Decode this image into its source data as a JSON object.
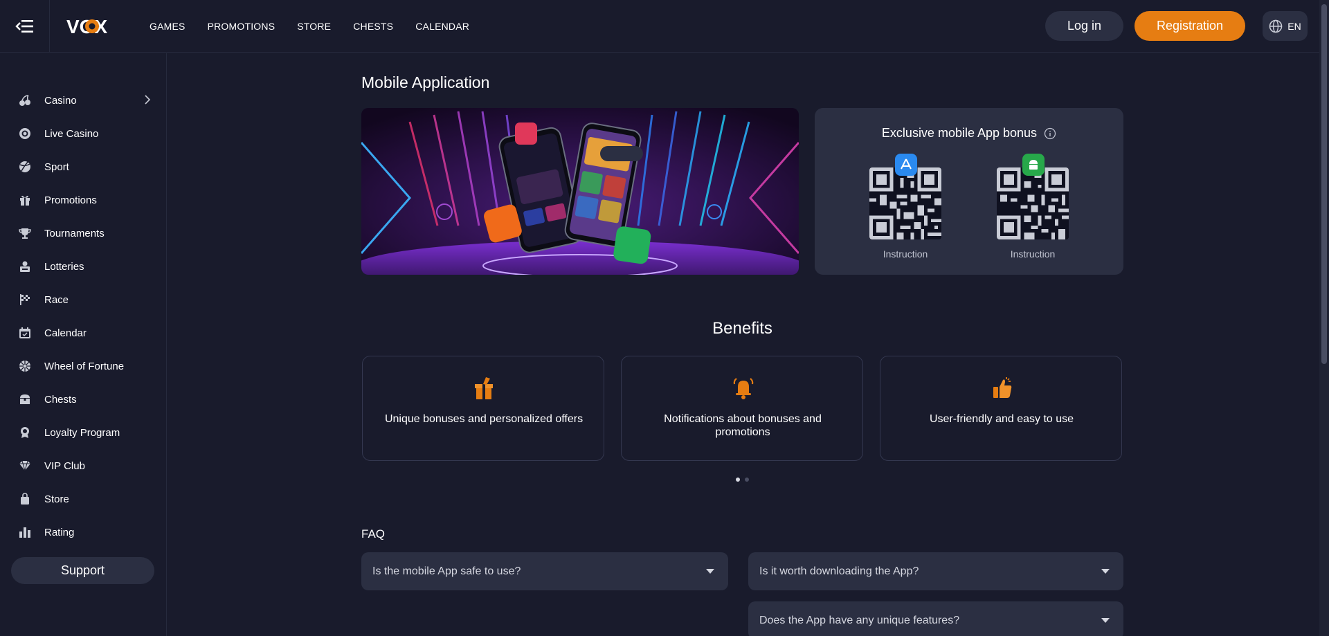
{
  "brand": {
    "logo_text": "VOX"
  },
  "topnav": {
    "items": [
      "GAMES",
      "PROMOTIONS",
      "STORE",
      "CHESTS",
      "CALENDAR"
    ]
  },
  "header": {
    "login_label": "Log in",
    "register_label": "Registration",
    "language": "EN"
  },
  "sidebar": {
    "items": [
      {
        "label": "Casino",
        "icon": "cherry-icon"
      },
      {
        "label": "Live Casino",
        "icon": "chip-icon"
      },
      {
        "label": "Sport",
        "icon": "ball-icon"
      },
      {
        "label": "Promotions",
        "icon": "gift-icon"
      },
      {
        "label": "Tournaments",
        "icon": "trophy-icon"
      },
      {
        "label": "Lotteries",
        "icon": "lottery-icon"
      },
      {
        "label": "Race",
        "icon": "flag-icon"
      },
      {
        "label": "Calendar",
        "icon": "calendar-icon"
      },
      {
        "label": "Wheel of Fortune",
        "icon": "wheel-icon"
      },
      {
        "label": "Chests",
        "icon": "chest-icon"
      },
      {
        "label": "Loyalty Program",
        "icon": "medal-icon"
      },
      {
        "label": "VIP Club",
        "icon": "diamond-icon"
      },
      {
        "label": "Store",
        "icon": "bag-icon"
      },
      {
        "label": "Rating",
        "icon": "rating-icon"
      }
    ],
    "support_label": "Support"
  },
  "main": {
    "title": "Mobile Application",
    "bonus": {
      "title": "Exclusive mobile App bonus",
      "ios_instruction": "Instruction",
      "android_instruction": "Instruction"
    },
    "benefits": {
      "title": "Benefits",
      "cards": [
        {
          "text": "Unique bonuses and personalized offers",
          "icon": "gift-icon"
        },
        {
          "text": "Notifications about bonuses and promotions",
          "icon": "bell-icon"
        },
        {
          "text": "User-friendly and easy to use",
          "icon": "thumbs-up-icon"
        }
      ],
      "pages": 2,
      "active_page": 1
    },
    "faq": {
      "title": "FAQ",
      "items": [
        "Is the mobile App safe to use?",
        "Is it worth downloading the App?",
        "Does the App have any unique features?"
      ]
    }
  },
  "colors": {
    "accent": "#e67d12",
    "background": "#191b2c",
    "card": "#2b2f42"
  }
}
